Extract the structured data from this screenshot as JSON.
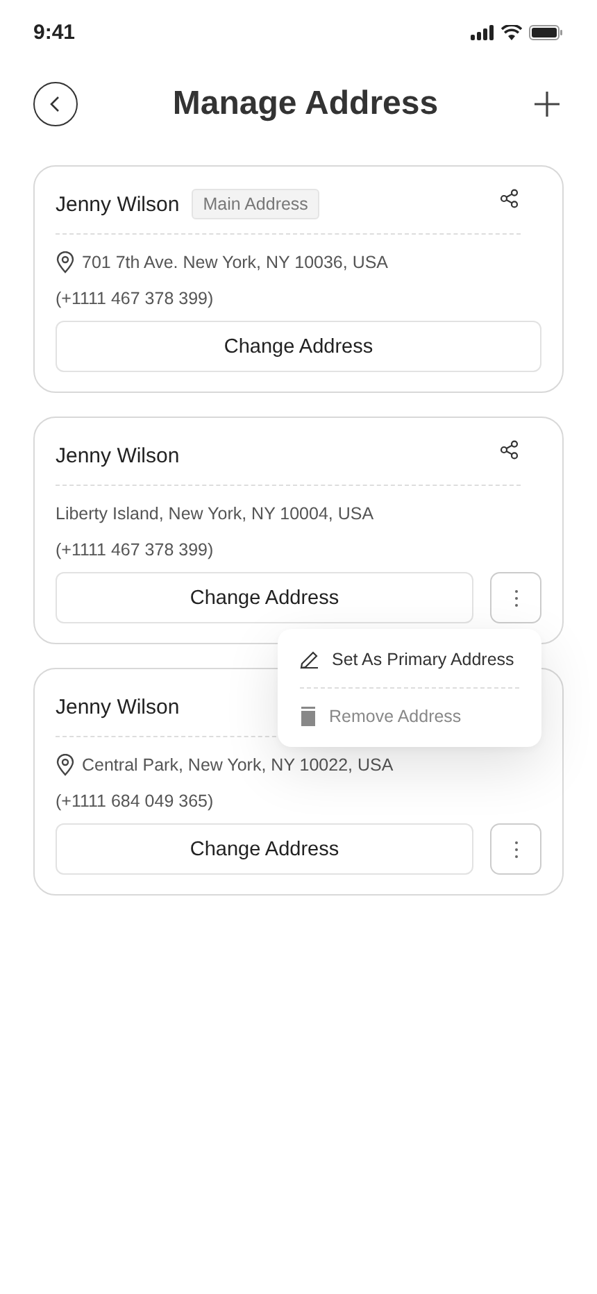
{
  "status_bar": {
    "time": "9:41"
  },
  "header": {
    "title": "Manage Address"
  },
  "addresses": [
    {
      "name": "Jenny Wilson",
      "badge": "Main Address",
      "address": "701 7th Ave. New York, NY 10036, USA",
      "pin": true,
      "phone": "(+1111 467 378 399)",
      "button": "Change Address",
      "share": true,
      "more": false,
      "menu_open": false
    },
    {
      "name": "Jenny Wilson",
      "address": "Liberty Island, New York, NY 10004, USA",
      "pin": false,
      "phone": "(+1111 467 378 399)",
      "button": "Change Address",
      "share": true,
      "more": true,
      "menu_open": true
    },
    {
      "name": "Jenny Wilson",
      "address": "Central Park, New York, NY 10022, USA",
      "pin": true,
      "phone": "(+1111 684 049 365)",
      "button": "Change Address",
      "share": false,
      "more": true,
      "menu_open": false
    }
  ],
  "menu": [
    {
      "kind": "edit",
      "label": "Set As Primary Address"
    },
    {
      "kind": "delete",
      "label": "Remove Address"
    }
  ]
}
